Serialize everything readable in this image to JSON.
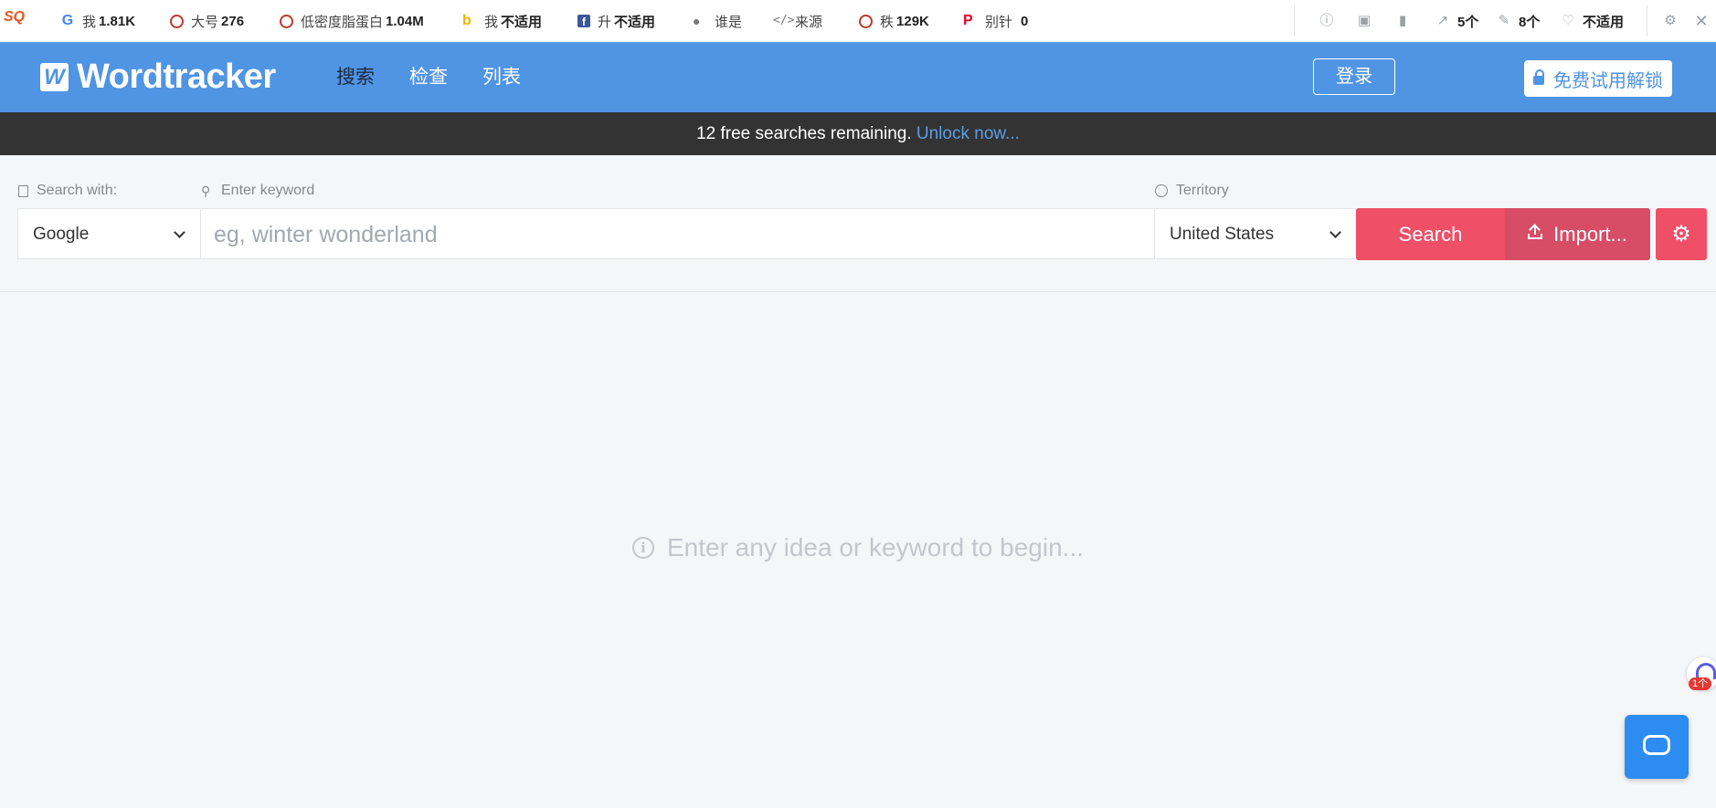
{
  "seo_toolbar": {
    "logo_text": "SQ",
    "items": [
      {
        "icon": "google-icon",
        "label": "我",
        "value": "1.81K"
      },
      {
        "icon": "ring-icon",
        "label": "大号",
        "value": "276"
      },
      {
        "icon": "ring-icon",
        "label": "低密度脂蛋白",
        "value": "1.04M"
      },
      {
        "icon": "bing-icon",
        "label": "我",
        "value": "不适用"
      },
      {
        "icon": "facebook-icon",
        "label": "升",
        "value": "不适用"
      },
      {
        "icon": "user-icon",
        "label": "谁是",
        "value": ""
      },
      {
        "icon": "code-icon",
        "label": "来源",
        "value": ""
      },
      {
        "icon": "ring-icon",
        "label": "秩",
        "value": "129K"
      },
      {
        "icon": "pinterest-icon",
        "label": "别针",
        "value": "0"
      }
    ],
    "right_items": [
      {
        "icon": "info-icon",
        "value": ""
      },
      {
        "icon": "monitor-icon",
        "value": ""
      },
      {
        "icon": "bar-chart-icon",
        "value": ""
      },
      {
        "icon": "external-link-icon",
        "value": "5个"
      },
      {
        "icon": "edit-icon",
        "value": "8个"
      },
      {
        "icon": "heart-icon",
        "value": "不适用"
      }
    ]
  },
  "header": {
    "brand_mark": "W",
    "brand_name": "Wordtracker",
    "nav": [
      "搜索",
      "检查",
      "列表"
    ],
    "login_label": "登录",
    "trial_label": "免费试用解锁"
  },
  "banner": {
    "text": "12 free searches remaining.",
    "link": "Unlock now..."
  },
  "search": {
    "search_with_label": "Search with:",
    "search_with_value": "Google",
    "keyword_label": "Enter keyword",
    "keyword_placeholder": "eg, winter wonderland",
    "territory_label": "Territory",
    "territory_value": "United States",
    "search_button": "Search",
    "import_button": "Import..."
  },
  "empty_state": {
    "message": "Enter any idea or keyword to begin..."
  },
  "side_widget": {
    "badge": "1个"
  },
  "colors": {
    "header_bg": "#5094e4",
    "banner_bg": "#333333",
    "search_button": "#ef4f67",
    "import_button": "#d74d66",
    "chat_button": "#2c8cf2"
  }
}
